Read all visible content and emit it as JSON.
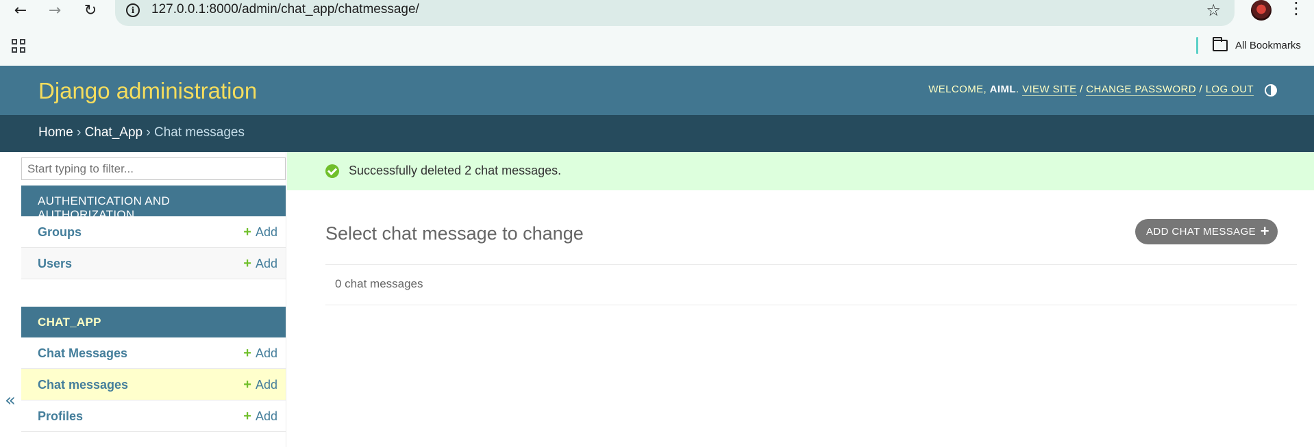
{
  "browser": {
    "url": "127.0.0.1:8000/admin/chat_app/chatmessage/",
    "bookmarks_label": "All Bookmarks"
  },
  "header": {
    "branding": "Django administration",
    "welcome": "WELCOME,",
    "username": "AIML",
    "view_site": "VIEW SITE",
    "change_password": "CHANGE PASSWORD",
    "log_out": "LOG OUT"
  },
  "breadcrumbs": {
    "home": "Home",
    "app": "Chat_App",
    "current": "Chat messages"
  },
  "sidebar": {
    "filter_placeholder": "Start typing to filter...",
    "modules": [
      {
        "caption": "AUTHENTICATION AND AUTHORIZATION",
        "models": [
          {
            "name": "Groups",
            "add": "Add"
          },
          {
            "name": "Users",
            "add": "Add"
          }
        ]
      },
      {
        "caption": "CHAT_APP",
        "models": [
          {
            "name": "Chat Messages",
            "add": "Add"
          },
          {
            "name": "Chat messages",
            "add": "Add"
          },
          {
            "name": "Profiles",
            "add": "Add"
          }
        ]
      }
    ],
    "collapse_glyph": "«"
  },
  "main": {
    "message": "Successfully deleted 2 chat messages.",
    "title": "Select chat message to change",
    "add_button": "ADD CHAT MESSAGE",
    "result_count": "0 chat messages"
  },
  "colors": {
    "header_bg": "#417690",
    "branding": "#f5dd5d",
    "breadcrumbs_bg": "#264b5d",
    "success_bg": "#ddffdd",
    "add_green": "#70bf2b",
    "link_blue": "#447e9b",
    "current_row": "#ffffcc"
  }
}
